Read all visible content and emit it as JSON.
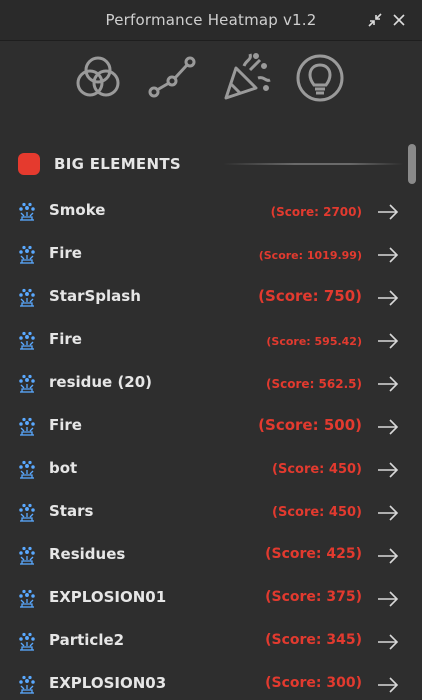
{
  "window": {
    "title": "Performance Heatmap v1.2"
  },
  "toolbar": {
    "buttons": [
      {
        "icon": "color-circles-icon"
      },
      {
        "icon": "line-graph-icon"
      },
      {
        "icon": "party-popper-icon"
      },
      {
        "icon": "lightbulb-icon"
      }
    ]
  },
  "section": {
    "title": "BIG ELEMENTS",
    "marker_color": "#e53a2e"
  },
  "colors": {
    "score": "#e23a2f",
    "icon_blue": "#5aa9ff"
  },
  "items": [
    {
      "name": "Smoke",
      "score": "(Score: 2700)"
    },
    {
      "name": "Fire",
      "score": "(Score: 1019.99)"
    },
    {
      "name": "StarSplash",
      "score": "(Score: 750)"
    },
    {
      "name": "Fire",
      "score": "(Score: 595.42)"
    },
    {
      "name": "residue (20)",
      "score": "(Score: 562.5)"
    },
    {
      "name": "Fire",
      "score": "(Score: 500)"
    },
    {
      "name": "bot",
      "score": "(Score: 450)"
    },
    {
      "name": "Stars",
      "score": "(Score: 450)"
    },
    {
      "name": "Residues",
      "score": "(Score: 425)"
    },
    {
      "name": "EXPLOSION01",
      "score": "(Score: 375)"
    },
    {
      "name": "Particle2",
      "score": "(Score: 345)"
    },
    {
      "name": "EXPLOSION03",
      "score": "(Score: 300)"
    }
  ]
}
